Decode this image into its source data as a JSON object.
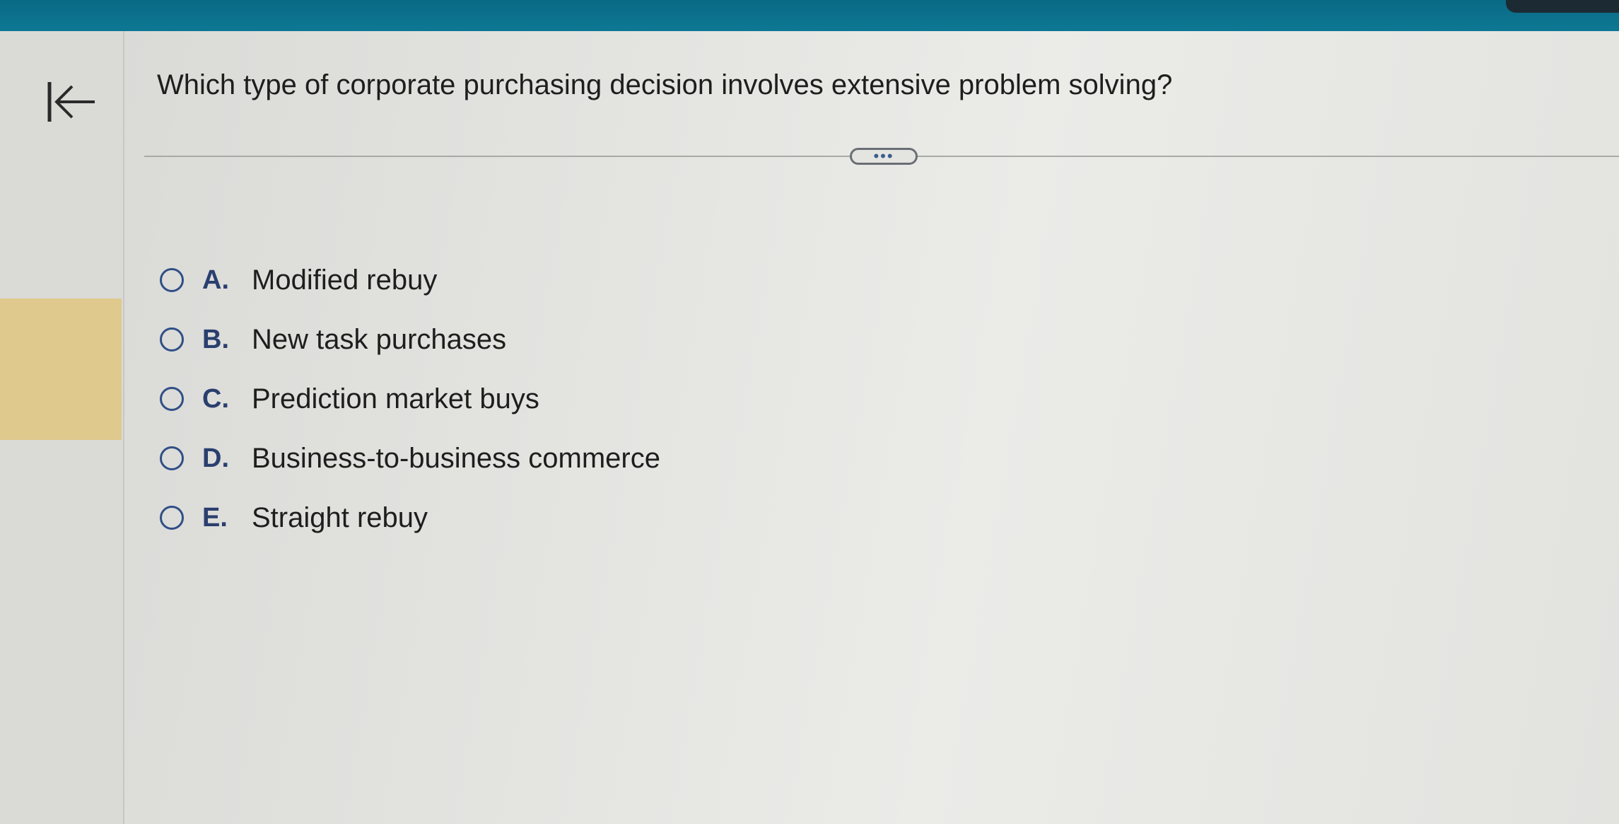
{
  "nav": {
    "back_icon": "first-page-arrow-icon"
  },
  "question": {
    "text": "Which type of corporate purchasing decision involves extensive problem solving?"
  },
  "more_button": {
    "label": "•••"
  },
  "options": [
    {
      "letter": "A.",
      "text": "Modified rebuy"
    },
    {
      "letter": "B.",
      "text": "New task purchases"
    },
    {
      "letter": "C.",
      "text": "Prediction market buys"
    },
    {
      "letter": "D.",
      "text": "Business-to-business commerce"
    },
    {
      "letter": "E.",
      "text": "Straight rebuy"
    }
  ],
  "colors": {
    "header": "#0e7a96",
    "radio": "#2f4f86",
    "highlight_tab": "#dfc98d"
  }
}
